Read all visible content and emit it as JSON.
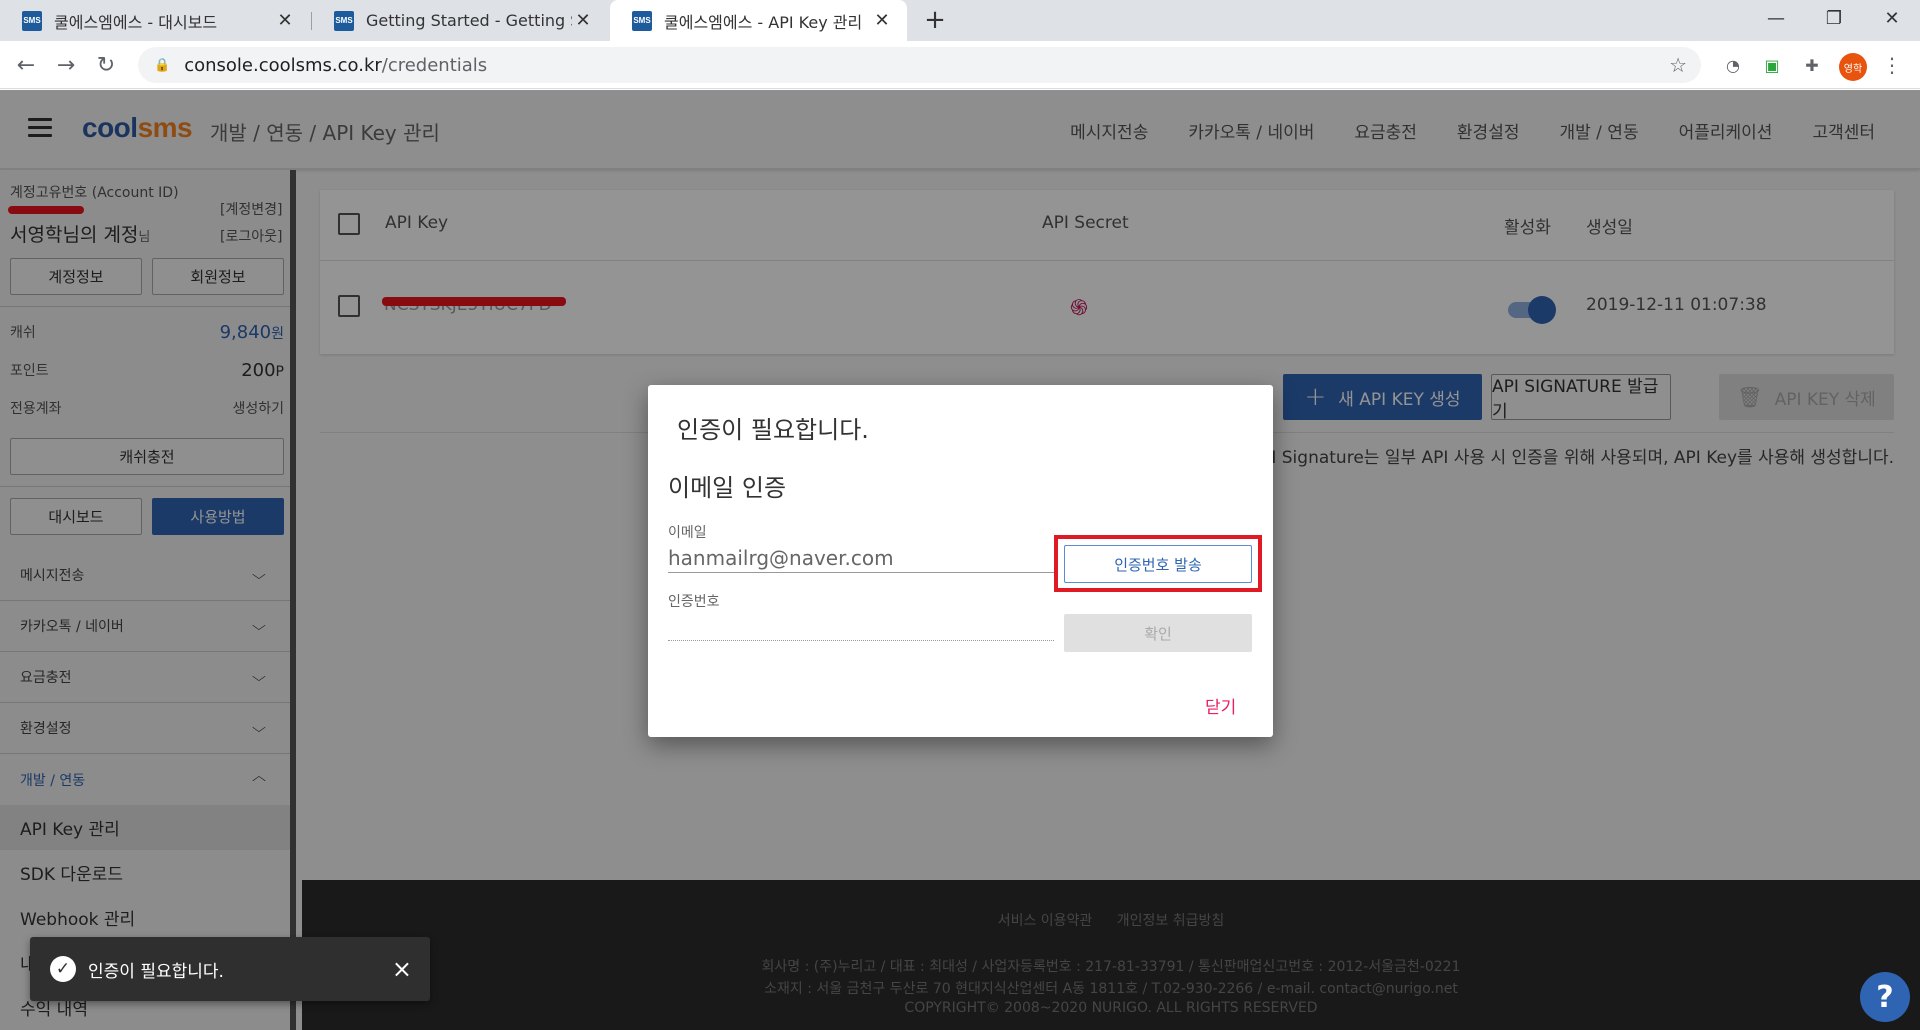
{
  "browser": {
    "tabs": [
      {
        "title": "쿨에스엠에스 - 대시보드",
        "favicon": "SMS"
      },
      {
        "title": "Getting Started - Getting Started",
        "favicon": "SMS"
      },
      {
        "title": "쿨에스엠에스 - API Key 관리",
        "favicon": "SMS"
      }
    ],
    "url_host": "console.coolsms.co.kr",
    "url_path": "/credentials",
    "profile_initials": "영학"
  },
  "header": {
    "logo_a": "cool",
    "logo_b": "sms",
    "breadcrumb": "개발 / 연동  /  API Key 관리",
    "nav": [
      "메시지전송",
      "카카오톡 / 네이버",
      "요금충전",
      "환경설정",
      "개발 / 연동",
      "어플리케이션",
      "고객센터"
    ]
  },
  "sidebar": {
    "account_id_label": "계정고유번호 (Account ID)",
    "change_account": "[계정변경]",
    "logout": "[로그아웃]",
    "account_name": "서영학님의 계정",
    "account_suffix": "님",
    "account_info_btn": "계정정보",
    "member_info_btn": "회원정보",
    "cash_label": "캐쉬",
    "cash_value": "9,840",
    "cash_unit": "원",
    "point_label": "포인트",
    "point_value": "200",
    "point_unit": "P",
    "dedicated_label": "전용계좌",
    "dedicated_value": "생성하기",
    "charge_btn": "캐쉬충전",
    "dashboard_btn": "대시보드",
    "usage_btn": "사용방법",
    "menus": [
      "메시지전송",
      "카카오톡 / 네이버",
      "요금충전",
      "환경설정",
      "개발 / 연동"
    ],
    "submenus": [
      "API Key 관리",
      "SDK 다운로드",
      "Webhook 관리",
      "내",
      "수익 내역"
    ]
  },
  "table": {
    "headers": {
      "api_key": "API Key",
      "api_secret": "API Secret",
      "active": "활성화",
      "created": "생성일"
    },
    "rows": [
      {
        "api_key": "NCSTSKJE5TIUC7FD",
        "created": "2019-12-11 01:07:38",
        "active": true
      }
    ]
  },
  "actions": {
    "new_key": "새 API KEY 생성",
    "signature": "API SIGNATURE 발급기",
    "delete_key": "API KEY 삭제",
    "notice": "API Signature는 일부 API 사용 시 인증을 위해 사용되며, API Key를 사용해 생성합니다."
  },
  "footer": {
    "terms": "서비스 이용약관",
    "privacy": "개인정보 취급방침",
    "line1": "회사명 : (주)누리고 / 대표 : 최대성 / 사업자등록번호 : 217-81-33791 / 통신판매업신고번호 : 2012-서울금천-0221",
    "line2": "소재지 : 서울 금천구 두산로 70 현대지식산업센터 A동 1811호 / T.02-930-2266 / e-mail. contact@nurigo.net",
    "line3": "COPYRIGHT© 2008~2020 NURIGO. ALL RIGHTS RESERVED"
  },
  "dialog": {
    "title": "인증이 필요합니다.",
    "subtitle": "이메일 인증",
    "email_label": "이메일",
    "email_value": "hanmailrg@naver.com",
    "code_label": "인증번호",
    "code_value": "",
    "send_btn": "인증번호 발송",
    "confirm_btn": "확인",
    "close": "닫기"
  },
  "snackbar": {
    "message": "인증이 필요합니다.",
    "close_icon": "×"
  },
  "colors": {
    "accent": "#2f64b3",
    "highlight": "#e01a24",
    "close_link": "#e91e63"
  }
}
